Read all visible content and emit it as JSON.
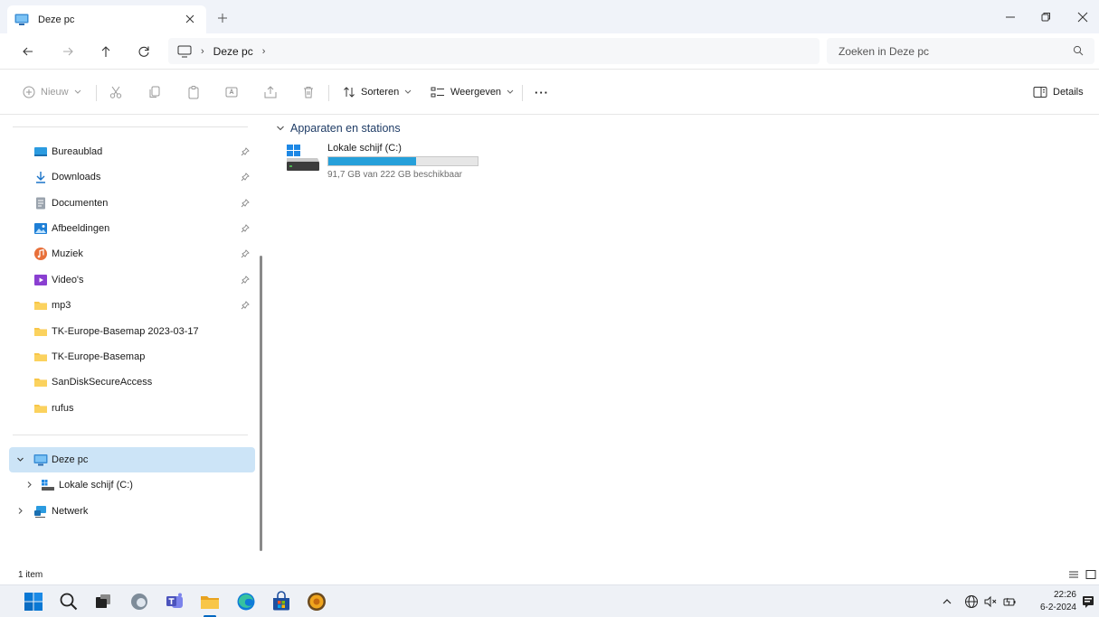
{
  "window": {
    "tab_title": "Deze pc",
    "tab_icon": "this-pc-icon",
    "controls": [
      "minimize-icon",
      "restore-icon",
      "close-icon"
    ]
  },
  "address": {
    "breadcrumb": [
      "Deze pc"
    ],
    "search_placeholder": "Zoeken in Deze pc"
  },
  "toolbar": {
    "new_label": "Nieuw",
    "sort_label": "Sorteren",
    "view_label": "Weergeven",
    "more_label": "···",
    "details_label": "Details"
  },
  "sidebar": {
    "quick_access": [
      {
        "label": "Bureaublad",
        "icon": "desktop-icon",
        "pinned": true
      },
      {
        "label": "Downloads",
        "icon": "download-icon",
        "pinned": true
      },
      {
        "label": "Documenten",
        "icon": "document-icon",
        "pinned": true
      },
      {
        "label": "Afbeeldingen",
        "icon": "pictures-icon",
        "pinned": true
      },
      {
        "label": "Muziek",
        "icon": "music-icon",
        "pinned": true
      },
      {
        "label": "Video's",
        "icon": "video-icon",
        "pinned": true
      },
      {
        "label": "mp3",
        "icon": "folder-icon",
        "pinned": true
      },
      {
        "label": "TK-Europe-Basemap 2023-03-17",
        "icon": "folder-icon",
        "pinned": false
      },
      {
        "label": "TK-Europe-Basemap",
        "icon": "folder-icon",
        "pinned": false
      },
      {
        "label": "SanDiskSecureAccess",
        "icon": "folder-icon",
        "pinned": false
      },
      {
        "label": "rufus",
        "icon": "folder-icon",
        "pinned": false
      }
    ],
    "tree": [
      {
        "label": "Deze pc",
        "icon": "this-pc-icon",
        "expanded": true,
        "selected": true
      },
      {
        "label": "Lokale schijf (C:)",
        "icon": "drive-icon",
        "expanded": false
      },
      {
        "label": "Netwerk",
        "icon": "network-icon",
        "expanded": false
      }
    ]
  },
  "content": {
    "group_title": "Apparaten en stations",
    "drives": [
      {
        "name": "Lokale schijf (C:)",
        "free_text": "91,7 GB van 222 GB beschikbaar",
        "used_fraction": 0.587,
        "bar_color": "#26a0da"
      }
    ]
  },
  "status": {
    "item_count": "1 item"
  },
  "taskbar": {
    "apps": [
      "windows-start-icon",
      "search-icon",
      "task-view-icon",
      "edge-beta-icon",
      "teams-icon",
      "file-explorer-icon",
      "edge-icon",
      "store-icon",
      "app-icon"
    ],
    "time": "22:26",
    "date": "6-2-2024"
  },
  "colors": {
    "accent": "#0067c0",
    "selection": "#cce4f7",
    "drive_bar": "#26a0da",
    "folder": "#f8c648"
  }
}
